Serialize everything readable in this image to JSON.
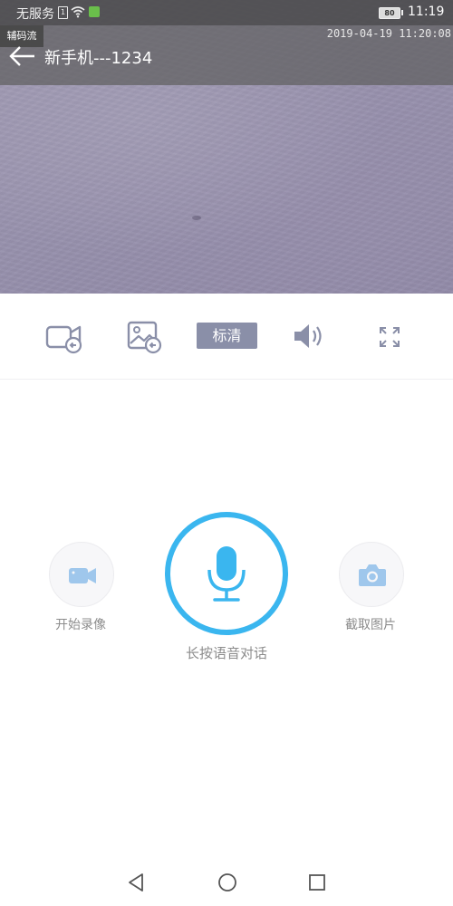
{
  "status_bar": {
    "carrier": "无服务",
    "sim_icon_label": "1",
    "battery_level": "80",
    "time": "11:19",
    "icons": [
      "sim-icon",
      "wifi-icon",
      "app-notification-icon",
      "battery-icon"
    ]
  },
  "video": {
    "stream_tag": "辅码流",
    "timestamp": "2019-04-19 11:20:08"
  },
  "header": {
    "title": "新手机---1234",
    "back_icon": "back-arrow-icon"
  },
  "toolbar": {
    "quality_label": "标清",
    "icons": [
      "video-playback-icon",
      "image-playback-icon",
      "speaker-icon",
      "fullscreen-icon"
    ]
  },
  "controls": {
    "record_label": "开始录像",
    "talk_label": "长按语音对话",
    "snapshot_label": "截取图片"
  },
  "colors": {
    "accent": "#3ab6ef",
    "icon_tint": "#8a8fa8",
    "side_icon": "#9fc7ec",
    "label": "#8c8c8c"
  },
  "nav": {
    "icons": [
      "nav-back-icon",
      "nav-home-icon",
      "nav-recents-icon"
    ]
  }
}
